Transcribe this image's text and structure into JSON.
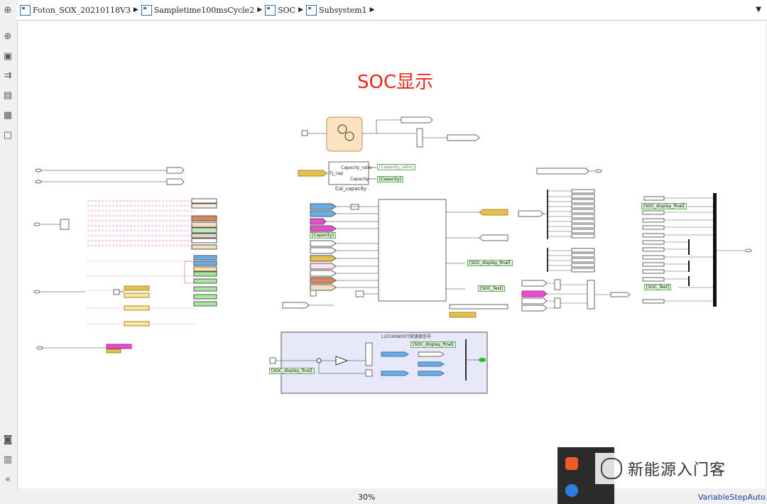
{
  "breadcrumb": {
    "items": [
      "Foton_SOX_20210118V3",
      "Sampletime100msCycle2",
      "SOC",
      "Subsystem1"
    ]
  },
  "canvas": {
    "title": "SOC显示",
    "cal_block": {
      "name": "Cal_capacity",
      "in_port": "Tj_cap",
      "out_ports": [
        "Capacity_ratio",
        "Capacity"
      ]
    },
    "tags": {
      "capacity_ratio": "[Capacity_ratio]",
      "capacity": "[Capacity]",
      "capacity_from": "[Capacity]",
      "soc_display_final_1": "[SOC_display_final]",
      "soc_test_1": "[SOC_Test]",
      "soc_display_final_2": "[SOC_display_final]",
      "soc_test_2": "[SOC_Test]",
      "soc_display_final_3": "[SOC_display_final]",
      "soc_display_final_4": "[SOC_display_final]"
    },
    "subsystem_title": "L2019080S行驶速度信号"
  },
  "status": {
    "zoom": "30%",
    "solver": "VariableStepAuto"
  },
  "watermark": {
    "text": "新能源入门客"
  },
  "colors": {
    "title_red": "#e8281c",
    "goto_green": "#dff5d6",
    "subsys_bg": "#e8e8fb"
  }
}
